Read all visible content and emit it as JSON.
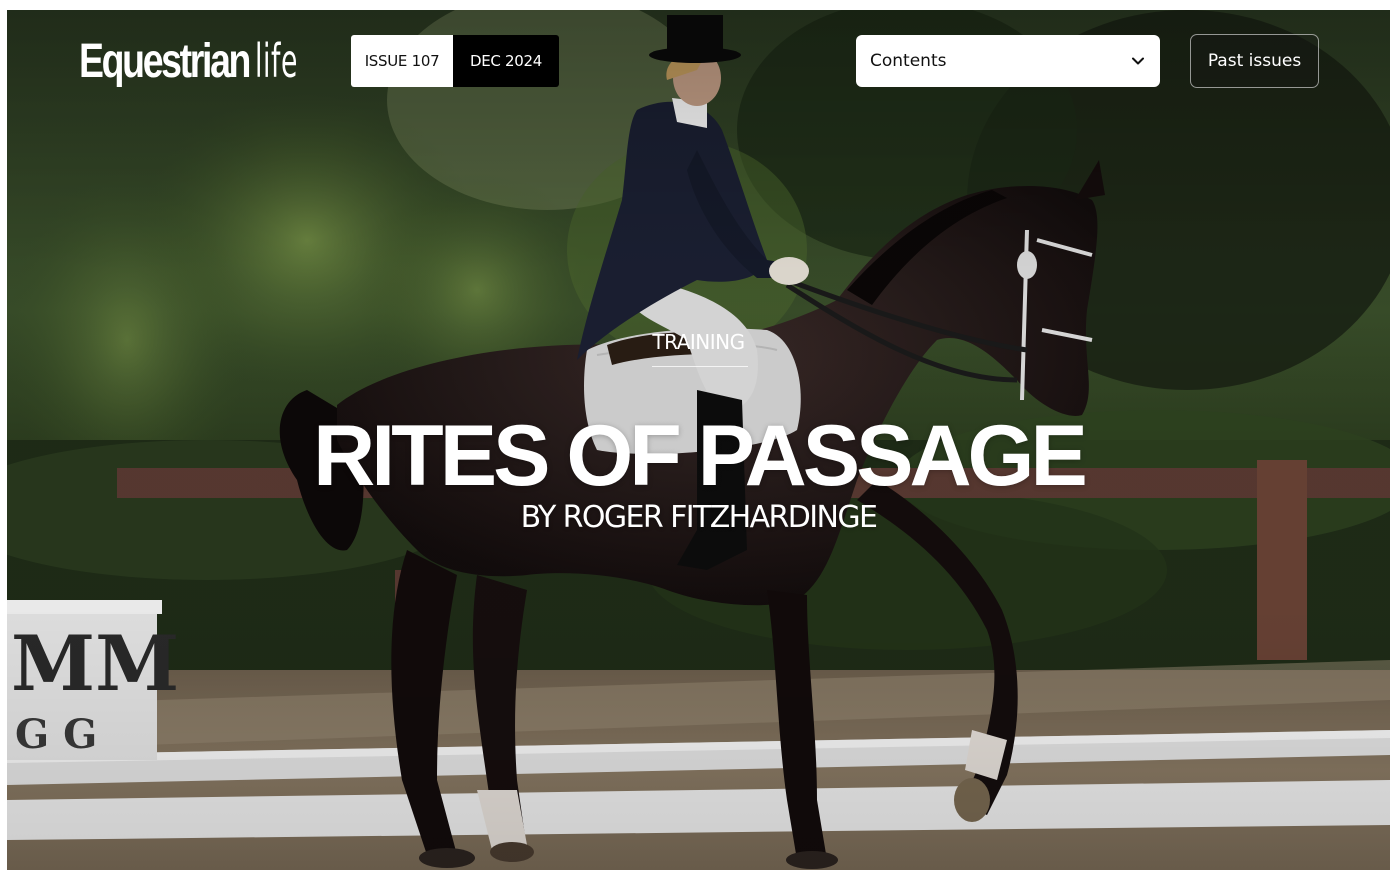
{
  "header": {
    "logo": {
      "primary": "Equestrian",
      "secondary": "life"
    },
    "issue": {
      "number": "ISSUE 107",
      "date": "DEC 2024"
    },
    "contents_select": {
      "selected": "Contents",
      "icon": "chevron-down-icon"
    },
    "past_issues_label": "Past issues"
  },
  "article": {
    "category": "TRAINING",
    "title": "RITES OF PASSAGE",
    "byline": "BY ROGER FITZHARDINGE"
  },
  "arena_marker": {
    "letters": [
      "M",
      "M",
      "G",
      "G"
    ]
  },
  "colors": {
    "text_light": "#ffffff",
    "badge_dark": "#000000",
    "badge_light": "#ffffff"
  }
}
